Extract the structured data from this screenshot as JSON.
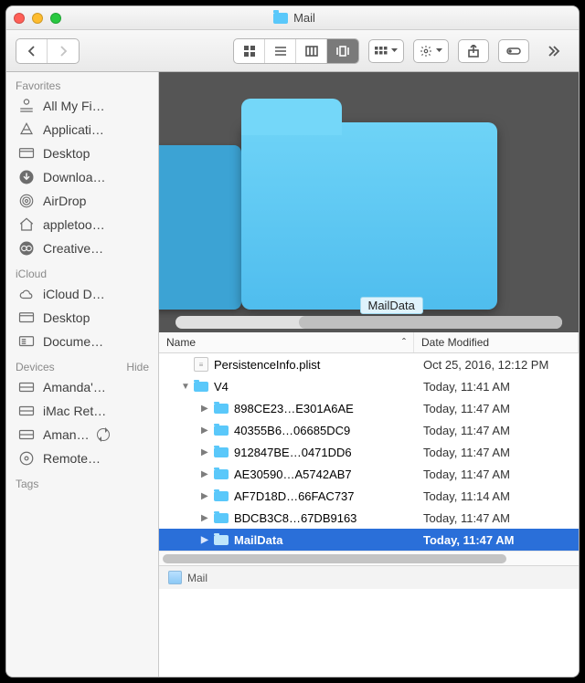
{
  "title": "Mail",
  "sidebar": {
    "sections": [
      {
        "label": "Favorites",
        "items": [
          {
            "icon": "allfiles",
            "label": "All My Fi…"
          },
          {
            "icon": "apps",
            "label": "Applicati…"
          },
          {
            "icon": "desktop",
            "label": "Desktop"
          },
          {
            "icon": "download",
            "label": "Downloa…"
          },
          {
            "icon": "airdrop",
            "label": "AirDrop"
          },
          {
            "icon": "home",
            "label": "appletoo…"
          },
          {
            "icon": "cc",
            "label": "Creative…"
          }
        ]
      },
      {
        "label": "iCloud",
        "items": [
          {
            "icon": "cloud",
            "label": "iCloud D…"
          },
          {
            "icon": "desktop",
            "label": "Desktop"
          },
          {
            "icon": "docs",
            "label": "Docume…"
          }
        ]
      },
      {
        "label": "Devices",
        "hide": "Hide",
        "items": [
          {
            "icon": "disk",
            "label": "Amanda'…"
          },
          {
            "icon": "disk",
            "label": "iMac Ret…"
          },
          {
            "icon": "disk",
            "label": "Aman…",
            "sync": true
          },
          {
            "icon": "optical",
            "label": "Remote…"
          }
        ]
      },
      {
        "label": "Tags",
        "items": []
      }
    ]
  },
  "cover": {
    "label": "MailData"
  },
  "columns": {
    "name": "Name",
    "date": "Date Modified"
  },
  "rows": [
    {
      "indent": 0,
      "tri": "",
      "type": "plist",
      "name": "PersistenceInfo.plist",
      "date": "Oct 25, 2016, 12:12 PM"
    },
    {
      "indent": 0,
      "tri": "▼",
      "type": "folder",
      "name": "V4",
      "date": "Today, 11:41 AM"
    },
    {
      "indent": 1,
      "tri": "▶",
      "type": "folder",
      "name": "898CE23…E301A6AE",
      "date": "Today, 11:47 AM"
    },
    {
      "indent": 1,
      "tri": "▶",
      "type": "folder",
      "name": "40355B6…06685DC9",
      "date": "Today, 11:47 AM"
    },
    {
      "indent": 1,
      "tri": "▶",
      "type": "folder",
      "name": "912847BE…0471DD6",
      "date": "Today, 11:47 AM"
    },
    {
      "indent": 1,
      "tri": "▶",
      "type": "folder",
      "name": "AE30590…A5742AB7",
      "date": "Today, 11:47 AM"
    },
    {
      "indent": 1,
      "tri": "▶",
      "type": "folder",
      "name": "AF7D18D…66FAC737",
      "date": "Today, 11:14 AM"
    },
    {
      "indent": 1,
      "tri": "▶",
      "type": "folder",
      "name": "BDCB3C8…67DB9163",
      "date": "Today, 11:47 AM"
    },
    {
      "indent": 1,
      "tri": "▶",
      "type": "folder",
      "name": "MailData",
      "date": "Today, 11:47 AM",
      "selected": true
    }
  ],
  "pathbar": {
    "label": "Mail"
  },
  "icons": {
    "allfiles": "<svg width='18' height='18' viewBox='0 0 24 24' fill='none' stroke='currentColor' stroke-width='1.6'><circle cx='12' cy='6' r='3.5'/><path d='M3 16h18M3 20h18'/></svg>",
    "apps": "<svg width='18' height='18' viewBox='0 0 24 24' fill='none' stroke='currentColor' stroke-width='1.6'><path d='M12 3 L20 18 H4 Z'/><path d='M8 12h8'/></svg>",
    "desktop": "<svg width='18' height='14' viewBox='0 0 24 18' fill='none' stroke='currentColor' stroke-width='1.6'><rect x='2' y='2' width='20' height='13' rx='1.5'/><path d='M2 6h20'/></svg>",
    "download": "<svg width='18' height='18' viewBox='0 0 24 24' fill='currentColor'><circle cx='12' cy='12' r='10' fill='#6d6d6d'/><path d='M12 6v8M8 11l4 4 4-4' stroke='#f6f6f6' stroke-width='2' fill='none'/></svg>",
    "airdrop": "<svg width='18' height='18' viewBox='0 0 24 24' fill='none' stroke='currentColor' stroke-width='1.5'><circle cx='12' cy='12' r='9'/><circle cx='12' cy='12' r='5.5'/><circle cx='12' cy='12' r='2'/></svg>",
    "home": "<svg width='18' height='18' viewBox='0 0 24 24' fill='none' stroke='currentColor' stroke-width='1.6'><path d='M3 11 L12 3 L21 11'/><path d='M5 10v10h14V10'/></svg>",
    "cc": "<svg width='18' height='18' viewBox='0 0 24 24' fill='currentColor'><circle cx='12' cy='12' r='10' fill='#6d6d6d'/><circle cx='8.5' cy='12' r='3.6' fill='none' stroke='#f6f6f6' stroke-width='1.5'/><circle cx='15.5' cy='12' r='3.6' fill='none' stroke='#f6f6f6' stroke-width='1.5'/></svg>",
    "cloud": "<svg width='18' height='14' viewBox='0 0 24 18' fill='none' stroke='currentColor' stroke-width='1.6'><path d='M7 15a4 4 0 010-8 5 5 0 019.6 1.5A3.5 3.5 0 0118 15H7z'/></svg>",
    "docs": "<svg width='18' height='14' viewBox='0 0 24 18' fill='none' stroke='currentColor' stroke-width='1.6'><rect x='2' y='2' width='20' height='13' rx='1.5'/><path d='M5 6h6M5 9h6M5 12h6'/></svg>",
    "disk": "<svg width='18' height='14' viewBox='0 0 24 18' fill='none' stroke='currentColor' stroke-width='1.6'><rect x='2' y='3' width='20' height='12' rx='1.5'/><path d='M2 9h20'/></svg>",
    "optical": "<svg width='18' height='18' viewBox='0 0 24 24' fill='none' stroke='currentColor' stroke-width='1.6'><circle cx='12' cy='12' r='9'/><circle cx='12' cy='12' r='2.5'/></svg>"
  }
}
